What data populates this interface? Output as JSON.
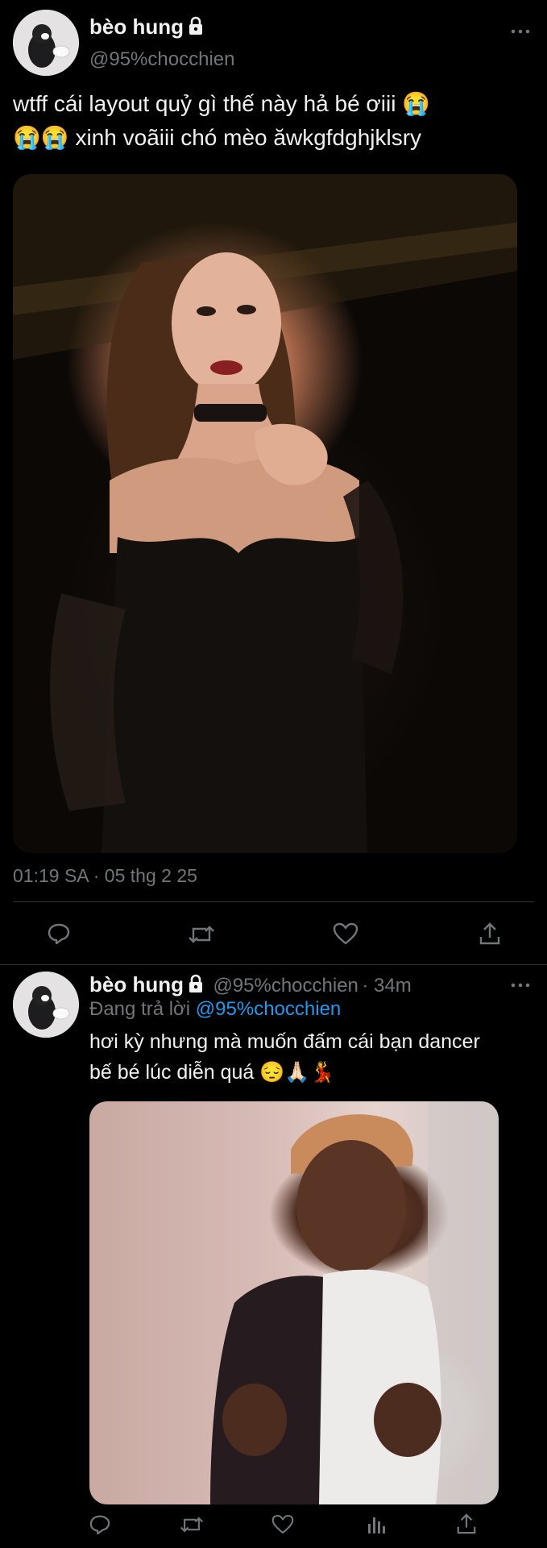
{
  "main_tweet": {
    "display_name": "bèo hung",
    "handle": "@95%chocchien",
    "text_line1": "wtff cái layout quỷ gì thế này hả bé ơiii 😭",
    "text_line2": "😭😭 xinh voãiii chó mèo ăwkgfdghjklsry",
    "timestamp": "01:19 SA · 05 thg 2 25"
  },
  "reply_tweet": {
    "display_name": "bèo hung",
    "handle": "@95%chocchien",
    "time": "· 34m",
    "replying_prefix": "Đang trả lời",
    "replying_to": "@95%chocchien",
    "text_line1": "hơi kỳ nhưng mà muốn đấm cái bạn dancer",
    "text_line2": "bế bé lúc diễn quá 😔🙏🏻💃"
  },
  "icons": {
    "more": "more-horizontal-icon",
    "reply": "reply-icon",
    "retweet": "retweet-icon",
    "like": "heart-icon",
    "share": "share-icon",
    "analytics": "analytics-icon",
    "lock": "lock-icon"
  },
  "colors": {
    "background": "#000000",
    "text": "#e7e9ea",
    "muted": "#71767b",
    "accent": "#1d9bf0"
  }
}
